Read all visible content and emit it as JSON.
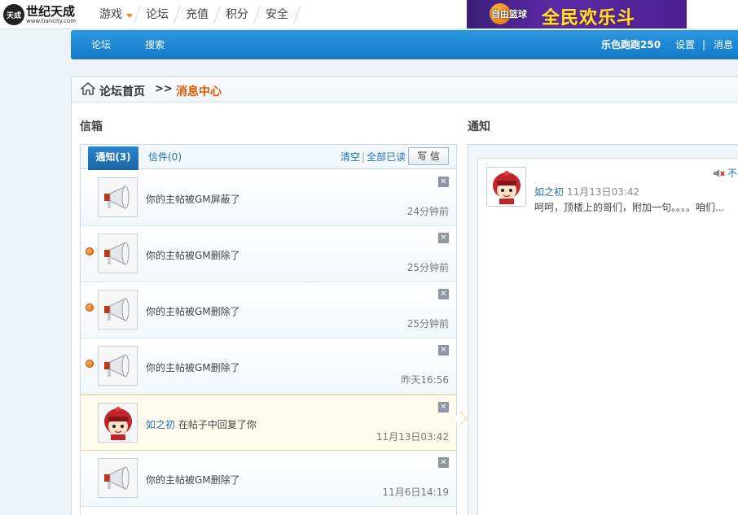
{
  "site": {
    "logo_icon_text": "天成",
    "logo_name": "世纪天成",
    "logo_url": "www.tiancity.com",
    "nav": [
      {
        "label": "游戏",
        "has_dropdown": true
      },
      {
        "label": "论坛"
      },
      {
        "label": "充值"
      },
      {
        "label": "积分"
      },
      {
        "label": "安全"
      }
    ],
    "banner": {
      "small_text": "自由篮球",
      "big_text": "全民欢乐斗"
    }
  },
  "forum_nav": {
    "left": [
      "论坛",
      "搜索"
    ],
    "username": "乐色跑跑250",
    "settings": "设置",
    "separator": "|",
    "messages": "消息"
  },
  "breadcrumb": {
    "home": "论坛首页",
    "arrow": ">>",
    "current": "消息中心"
  },
  "inbox": {
    "title": "信箱",
    "tab_notice": "通知(3)",
    "tab_mail": "信件(0)",
    "action_clear": "清空",
    "action_separator": "|",
    "action_read_all": "全部已读",
    "write_button": "写 信",
    "messages": [
      {
        "text": "你的主帖被GM屏蔽了",
        "time": "24分钟前",
        "unread": false,
        "avatar": "megaphone-icon"
      },
      {
        "text": "你的主帖被GM删除了",
        "time": "25分钟前",
        "unread": true,
        "avatar": "megaphone-icon"
      },
      {
        "text": "你的主帖被GM删除了",
        "time": "25分钟前",
        "unread": true,
        "avatar": "megaphone-icon"
      },
      {
        "text": "你的主帖被GM删除了",
        "time": "昨天16:56",
        "unread": true,
        "avatar": "megaphone-icon"
      },
      {
        "user": "如之初",
        "text": " 在帖子中回复了你",
        "time": "11月13日03:42",
        "unread": false,
        "selected": true,
        "avatar": "user-avatar"
      },
      {
        "text": "你的主帖被GM删除了",
        "time": "11月6日14:19",
        "unread": false,
        "avatar": "megaphone-icon"
      }
    ]
  },
  "notice": {
    "title": "通知",
    "mute_label": "不再",
    "user": "如之初",
    "time": "11月13日03:42",
    "body": "呵呵，顶楼上的哥们，附加一句。。。。咱们..."
  },
  "colors": {
    "accent_blue": "#1f6fb5",
    "nav_blue": "#1479c7",
    "breadcrumb_orange": "#e05a00",
    "unread_orange": "#e46500"
  }
}
